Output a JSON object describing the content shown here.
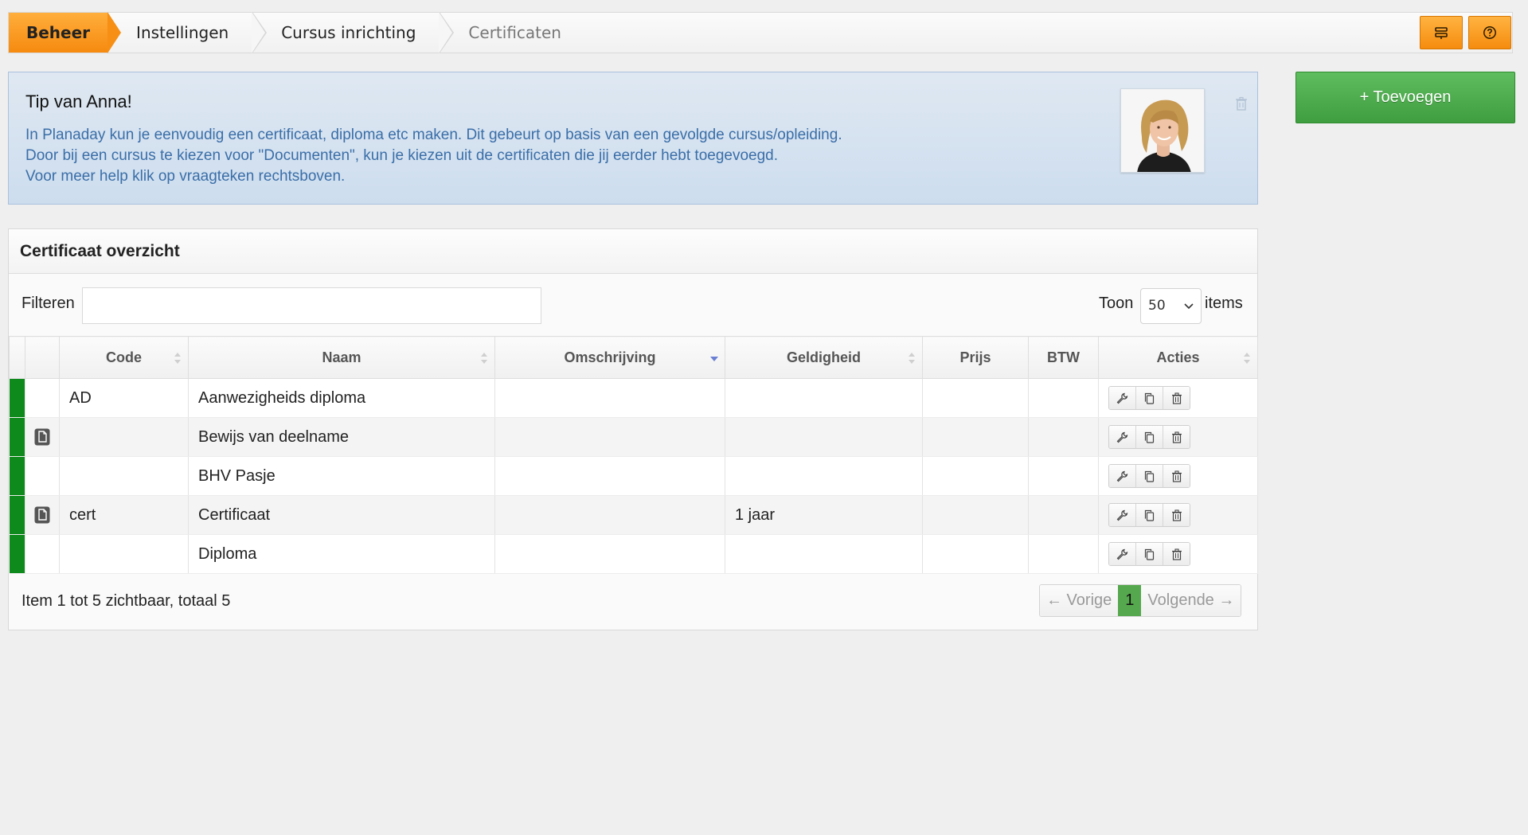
{
  "breadcrumb": [
    "Beheer",
    "Instellingen",
    "Cursus inrichting",
    "Certificaten"
  ],
  "toolbar": {
    "settings_icon": "list-settings-icon",
    "help_icon": "question-circle-icon"
  },
  "tip": {
    "title": "Tip van Anna!",
    "lines": [
      "In Planaday kun je eenvoudig een certificaat, diploma etc maken. Dit gebeurt op basis van een gevolgde cursus/opleiding.",
      "Door bij een cursus te kiezen voor \"Documenten\", kun je kiezen uit de certificaten die jij eerder hebt toegevoegd.",
      "Voor meer help klik op vraagteken rechtsboven."
    ]
  },
  "add_button": "+ Toevoegen",
  "panel": {
    "title": "Certificaat overzicht",
    "filter_label": "Filteren",
    "filter_value": "",
    "show_label": "Toon",
    "show_value": "50",
    "items_label": "items"
  },
  "table": {
    "columns": [
      "Code",
      "Naam",
      "Omschrijving",
      "Geldigheid",
      "Prijs",
      "BTW",
      "Acties"
    ],
    "rows": [
      {
        "has_doc": false,
        "code": "AD",
        "naam": "Aanwezigheids diploma",
        "omschrijving": "",
        "geldigheid": "",
        "prijs": "",
        "btw": ""
      },
      {
        "has_doc": true,
        "code": "",
        "naam": "Bewijs van deelname",
        "omschrijving": "",
        "geldigheid": "",
        "prijs": "",
        "btw": ""
      },
      {
        "has_doc": false,
        "code": "",
        "naam": "BHV Pasje",
        "omschrijving": "",
        "geldigheid": "",
        "prijs": "",
        "btw": ""
      },
      {
        "has_doc": true,
        "code": "cert",
        "naam": "Certificaat",
        "omschrijving": "",
        "geldigheid": "1 jaar",
        "prijs": "",
        "btw": ""
      },
      {
        "has_doc": false,
        "code": "",
        "naam": "Diploma",
        "omschrijving": "",
        "geldigheid": "",
        "prijs": "",
        "btw": ""
      }
    ]
  },
  "footer": {
    "summary": "Item 1 tot 5 zichtbaar, totaal 5",
    "prev": "← Vorige",
    "page": "1",
    "next": "Volgende →"
  },
  "colors": {
    "accent_orange": "#f68a0f",
    "accent_green": "#4caf50",
    "status_green": "#0d8a1b",
    "tip_text": "#3a6ea8"
  }
}
